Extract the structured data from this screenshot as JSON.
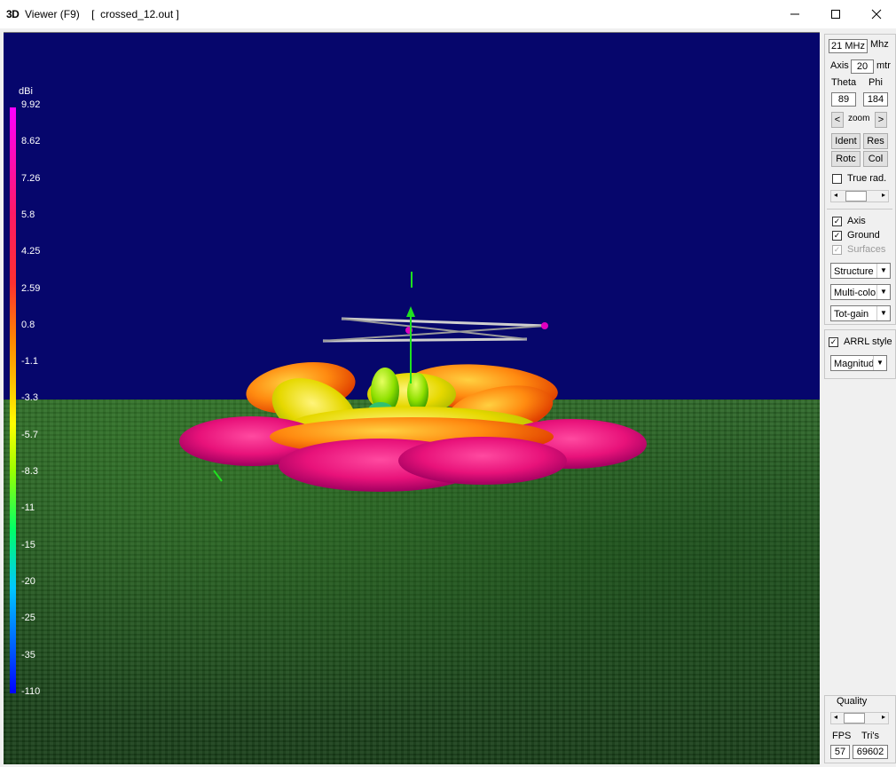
{
  "window": {
    "icon_text": "3D",
    "title": "Viewer (F9)    [  crossed_12.out ]"
  },
  "colorscale": {
    "unit": "dBi",
    "ticks": [
      "9.92",
      "8.62",
      "7.26",
      "5.8",
      "4.25",
      "2.59",
      "0.8",
      "-1.1",
      "-3.3",
      "-5.7",
      "-8.3",
      "-11",
      "-15",
      "-20",
      "-25",
      "-35",
      "-110"
    ]
  },
  "panel": {
    "freq_value": "21 MHz",
    "freq_unit": "Mhz",
    "axis_label": "Axis",
    "axis_value": "20",
    "axis_unit": "mtr",
    "theta_label": "Theta",
    "phi_label": "Phi",
    "theta_value": "89",
    "phi_value": "184",
    "zoom_left": "<",
    "zoom_label": "zoom",
    "zoom_right": ">",
    "ident": "Ident",
    "res": "Res",
    "rotc": "Rotc",
    "col": "Col",
    "true_rad": "True rad.",
    "axis_cb": "Axis",
    "ground_cb": "Ground",
    "surfaces_cb": "Surfaces",
    "dd_structure": "Structure",
    "dd_color": "Multi-colo",
    "dd_gain": "Tot-gain",
    "arrl_style": "ARRL style",
    "dd_magnitude": "Magnitud",
    "quality_label": "Quality",
    "fps_label": "FPS",
    "tris_label": "Tri's",
    "fps_value": "57",
    "tris_value": "69602"
  },
  "colors": {
    "sky": "#06066c",
    "ground": "#2f6a2a",
    "lobe_max": "#ff1aa0",
    "lobe_mid": "#ffb000",
    "lobe_low": "#b8f000"
  }
}
